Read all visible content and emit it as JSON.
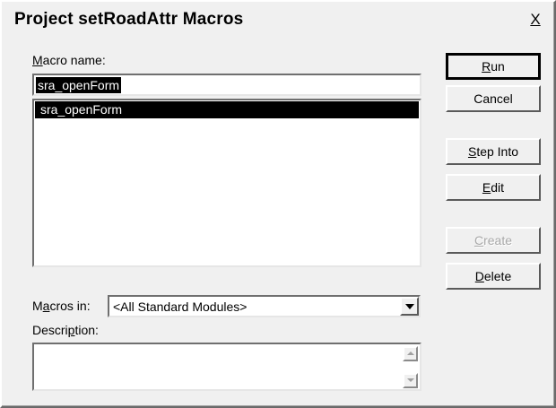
{
  "window": {
    "title": "Project setRoadAttr Macros",
    "close_label": "X"
  },
  "macro_name": {
    "label_prefix": "",
    "label_accel": "M",
    "label_rest": "acro name:",
    "value": "sra_openForm"
  },
  "macro_list": {
    "items": [
      {
        "label": "sra_openForm",
        "selected": true
      }
    ]
  },
  "buttons": {
    "run": {
      "accel": "R",
      "rest": "un"
    },
    "cancel": {
      "label": "Cancel"
    },
    "step_into": {
      "accel": "S",
      "rest": "tep Into"
    },
    "edit": {
      "accel": "E",
      "rest": "dit"
    },
    "create": {
      "accel": "C",
      "rest": "reate",
      "disabled": true
    },
    "delete": {
      "accel": "D",
      "rest": "elete"
    }
  },
  "macros_in": {
    "label_prefix": "M",
    "label_accel": "a",
    "label_rest": "cros in:",
    "selected": "<All Standard Modules>"
  },
  "description": {
    "label_prefix": "Descri",
    "label_accel": "p",
    "label_rest": "tion:",
    "value": ""
  },
  "colors": {
    "dialog_bg": "#f0f0f0",
    "selection_bg": "#000000",
    "selection_fg": "#ffffff",
    "disabled_text": "#a8a8a8"
  }
}
